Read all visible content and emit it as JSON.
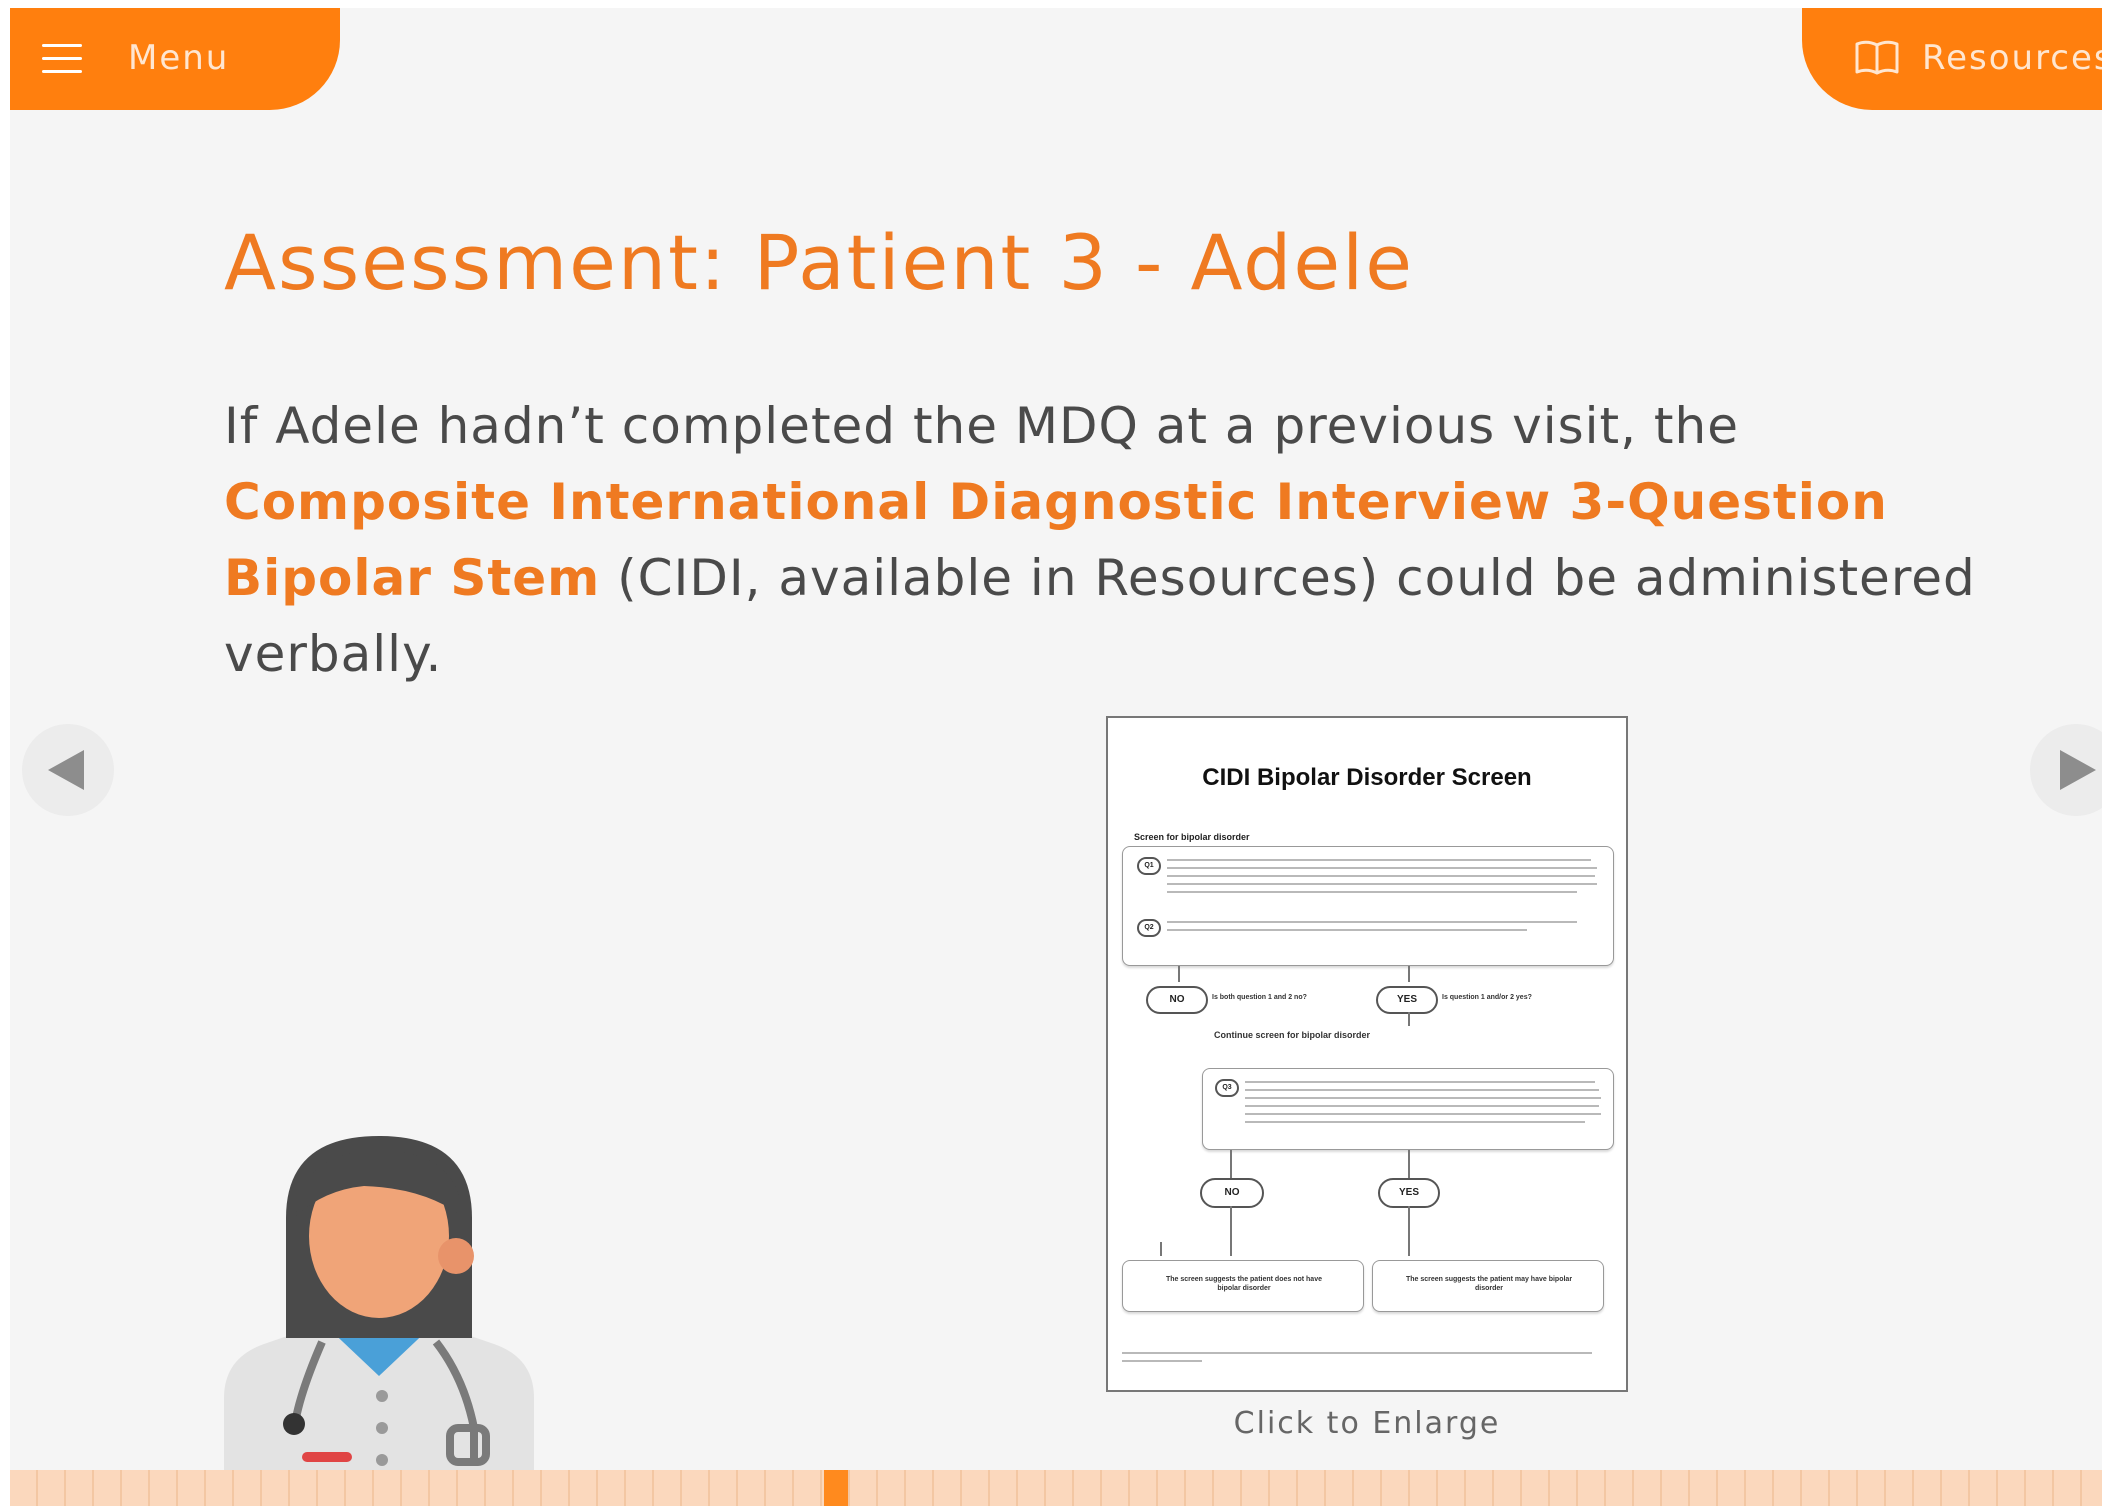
{
  "header": {
    "menu_label": "Menu",
    "resources_label": "Resources",
    "accent_color": "#ff7f0e"
  },
  "main": {
    "title": "Assessment: Patient 3 - Adele",
    "body_before": "If Adele hadn’t completed the MDQ at a previous visit, the ",
    "body_link": "Composite International Diagnostic Interview 3-Question Bipolar Stem",
    "body_after": " (CIDI, available in Resources) could be administered verbally."
  },
  "document": {
    "title": "CIDI Bipolar Disorder Screen",
    "section_label": "Screen for bipolar disorder",
    "continue_label": "Continue screen for bipolar disorder",
    "q1": "Q1",
    "q2": "Q2",
    "q3": "Q3",
    "no": "NO",
    "yes": "YES",
    "no_note": "Is both question 1 and 2 no?",
    "yes_note": "Is question 1 and/or 2 yes?",
    "result_no": "The screen suggests the patient does not have bipolar disorder",
    "result_yes": "The screen suggests the patient may have bipolar disorder"
  },
  "enlarge_label": "Click to Enlarge",
  "navigation": {
    "prev_icon": "triangle-left-icon",
    "next_icon": "triangle-right-icon"
  },
  "progress": {
    "current_fraction": 0.395
  }
}
